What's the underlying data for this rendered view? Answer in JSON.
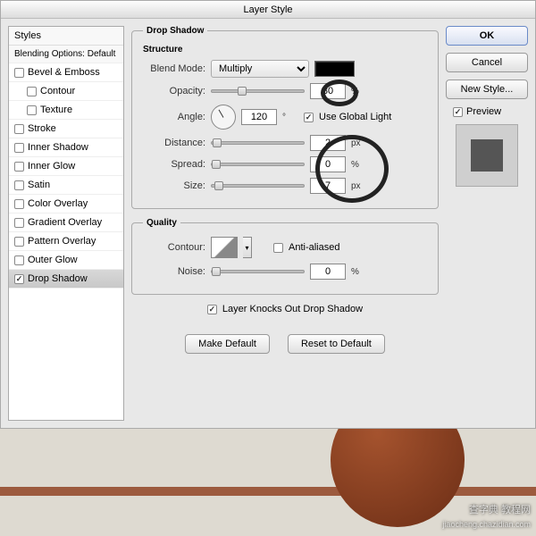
{
  "title": "Layer Style",
  "sidebar": {
    "header": "Styles",
    "subheader": "Blending Options: Default",
    "items": [
      {
        "label": "Bevel & Emboss",
        "checked": false,
        "indent": false
      },
      {
        "label": "Contour",
        "checked": false,
        "indent": true
      },
      {
        "label": "Texture",
        "checked": false,
        "indent": true
      },
      {
        "label": "Stroke",
        "checked": false,
        "indent": false
      },
      {
        "label": "Inner Shadow",
        "checked": false,
        "indent": false
      },
      {
        "label": "Inner Glow",
        "checked": false,
        "indent": false
      },
      {
        "label": "Satin",
        "checked": false,
        "indent": false
      },
      {
        "label": "Color Overlay",
        "checked": false,
        "indent": false
      },
      {
        "label": "Gradient Overlay",
        "checked": false,
        "indent": false
      },
      {
        "label": "Pattern Overlay",
        "checked": false,
        "indent": false
      },
      {
        "label": "Outer Glow",
        "checked": false,
        "indent": false
      },
      {
        "label": "Drop Shadow",
        "checked": true,
        "indent": false,
        "selected": true
      }
    ]
  },
  "panel": {
    "title": "Drop Shadow",
    "structure": {
      "legend": "Structure",
      "blend_mode_label": "Blend Mode:",
      "blend_mode_value": "Multiply",
      "opacity_label": "Opacity:",
      "opacity_value": "30",
      "opacity_unit": "%",
      "angle_label": "Angle:",
      "angle_value": "120",
      "angle_unit": "°",
      "global_light_label": "Use Global Light",
      "distance_label": "Distance:",
      "distance_value": "2",
      "distance_unit": "px",
      "spread_label": "Spread:",
      "spread_value": "0",
      "spread_unit": "%",
      "size_label": "Size:",
      "size_value": "7",
      "size_unit": "px"
    },
    "quality": {
      "legend": "Quality",
      "contour_label": "Contour:",
      "antialias_label": "Anti-aliased",
      "noise_label": "Noise:",
      "noise_value": "0",
      "noise_unit": "%"
    },
    "knockout_label": "Layer Knocks Out Drop Shadow",
    "make_default": "Make Default",
    "reset_default": "Reset to Default"
  },
  "buttons": {
    "ok": "OK",
    "cancel": "Cancel",
    "new_style": "New Style...",
    "preview": "Preview"
  },
  "watermark": {
    "main": "查字典 教程网",
    "sub": "jiaocheng.chazidian.com"
  }
}
